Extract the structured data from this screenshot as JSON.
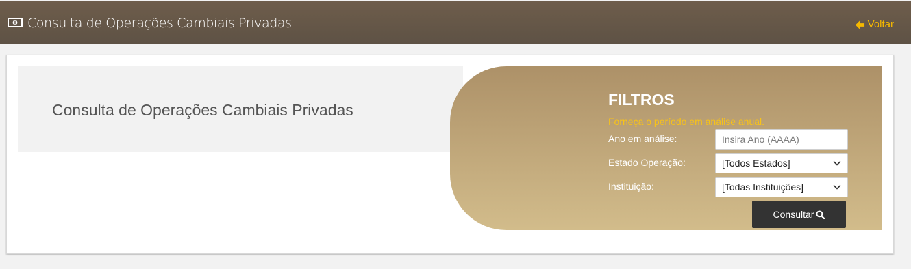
{
  "header": {
    "title": "Consulta de Operações Cambiais Privadas",
    "back_label": "Voltar",
    "icon": "money-bill-icon",
    "back_icon": "arrow-left-icon"
  },
  "banner": {
    "title": "Consulta de Operações Cambiais Privadas"
  },
  "filters": {
    "title": "FILTROS",
    "hint": "Forneça o período em análise anual.",
    "year_label": "Ano em análise:",
    "year_placeholder": "Insira Ano (AAAA)",
    "state_label": "Estado Operação:",
    "state_value": "[Todos Estados]",
    "institution_label": "Instituição:",
    "institution_value": "[Todas Instituições]",
    "consult_label": "Consultar",
    "consult_icon": "search-icon"
  },
  "colors": {
    "header_bg": "#5e5245",
    "accent": "#f5b800",
    "filter_gradient_top": "#ad9168",
    "filter_gradient_bottom": "#d2bc8b",
    "button_bg": "#333333"
  }
}
